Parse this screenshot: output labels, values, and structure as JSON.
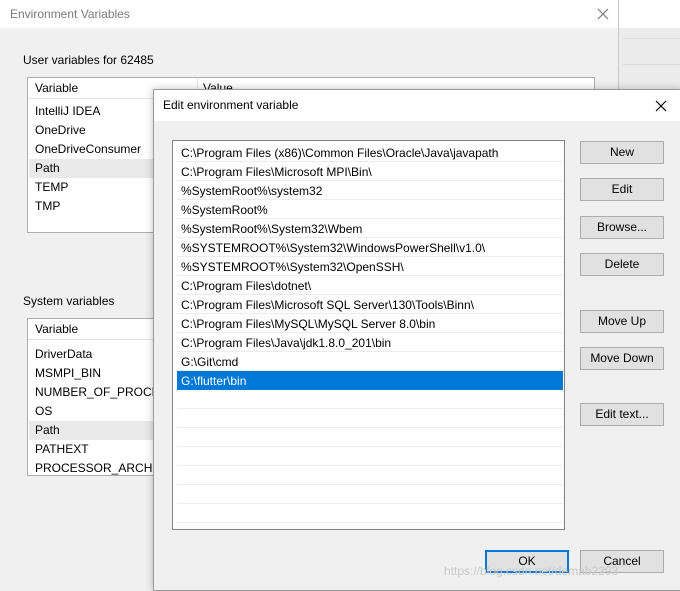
{
  "background_window": {
    "title": "Environment Variables",
    "user_group_label": "User variables for 62485",
    "user_header": {
      "variable": "Variable",
      "value": "Value"
    },
    "user_items": [
      "IntelliJ IDEA",
      "OneDrive",
      "OneDriveConsumer",
      "Path",
      "TEMP",
      "TMP"
    ],
    "system_group_label": "System variables",
    "system_header": {
      "variable": "Variable"
    },
    "system_items": [
      "DriverData",
      "MSMPI_BIN",
      "NUMBER_OF_PROCESS",
      "OS",
      "Path",
      "PATHEXT",
      "PROCESSOR_ARCHITE"
    ]
  },
  "dialog": {
    "title": "Edit environment variable",
    "paths": [
      "C:\\Program Files (x86)\\Common Files\\Oracle\\Java\\javapath",
      "C:\\Program Files\\Microsoft MPI\\Bin\\",
      "%SystemRoot%\\system32",
      "%SystemRoot%",
      "%SystemRoot%\\System32\\Wbem",
      "%SYSTEMROOT%\\System32\\WindowsPowerShell\\v1.0\\",
      "%SYSTEMROOT%\\System32\\OpenSSH\\",
      "C:\\Program Files\\dotnet\\",
      "C:\\Program Files\\Microsoft SQL Server\\130\\Tools\\Binn\\",
      "C:\\Program Files\\MySQL\\MySQL Server 8.0\\bin",
      "C:\\Program Files\\Java\\jdk1.8.0_201\\bin",
      "G:\\Git\\cmd",
      "G:\\flutter\\bin"
    ],
    "selected_index": 12,
    "buttons": {
      "new": "New",
      "edit": "Edit",
      "browse": "Browse...",
      "delete": "Delete",
      "move_up": "Move Up",
      "move_down": "Move Down",
      "edit_text": "Edit text...",
      "ok": "OK",
      "cancel": "Cancel"
    }
  },
  "watermark": "https://blog.csdn.net/demab2293",
  "colors": {
    "selection": "#0078d7",
    "button_face": "#e1e1e1",
    "dialog_bg": "#f0f0f0"
  }
}
